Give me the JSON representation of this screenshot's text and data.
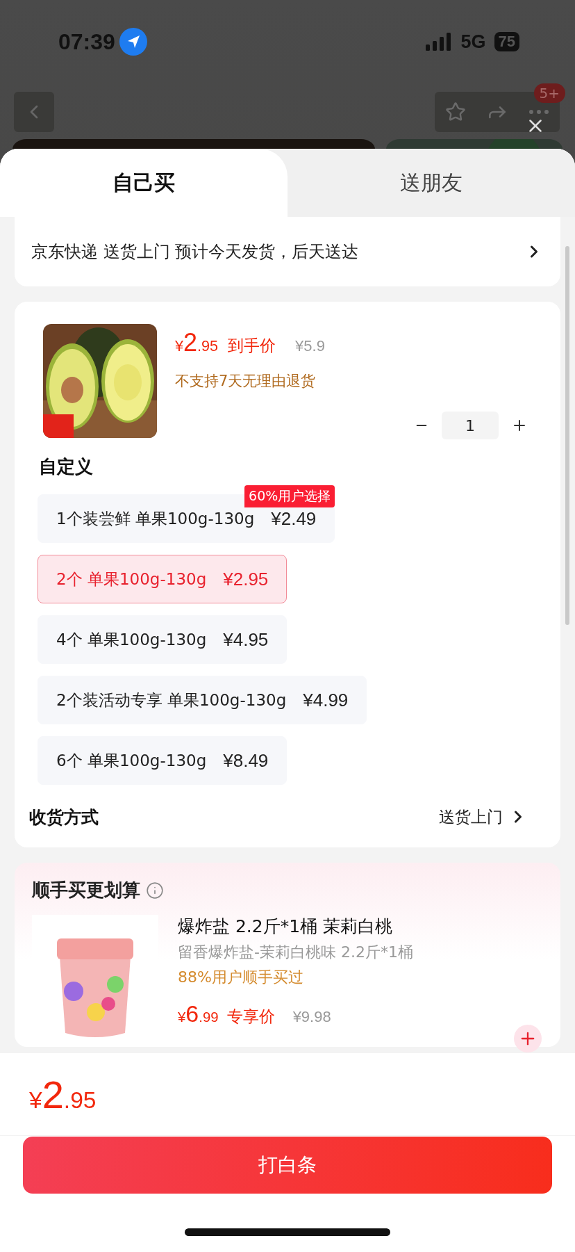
{
  "status_bar": {
    "time": "07:39",
    "network": "5G",
    "battery": "75"
  },
  "nav": {
    "badge": "5+"
  },
  "tabs": [
    {
      "label": "自己买",
      "selected": true
    },
    {
      "label": "送朋友",
      "selected": false
    }
  ],
  "delivery": {
    "text": "京东快递 送货上门 预计今天发货，后天送达"
  },
  "product": {
    "currency": "¥",
    "price_int": "2",
    "price_dec": ".95",
    "price_label": "到手价",
    "original_price": "¥5.9",
    "notice": "不支持7天无理由退货",
    "quantity": "1"
  },
  "spec": {
    "title": "自定义",
    "options": [
      {
        "label": "1个装尝鲜 单果100g-130g",
        "price": "¥2.49",
        "selected": false,
        "badge": "60%用户选择"
      },
      {
        "label": "2个 单果100g-130g",
        "price": "¥2.95",
        "selected": true
      },
      {
        "label": "4个 单果100g-130g",
        "price": "¥4.95",
        "selected": false
      },
      {
        "label": "2个装活动专享 单果100g-130g",
        "price": "¥4.99",
        "selected": false
      },
      {
        "label": "6个 单果100g-130g",
        "price": "¥8.49",
        "selected": false
      }
    ]
  },
  "receive": {
    "label": "收货方式",
    "value": "送货上门"
  },
  "upsell": {
    "title": "顺手买更划算",
    "items": [
      {
        "title": "爆炸盐 2.2斤*1桶 茉莉白桃",
        "subtitle": "留香爆炸盐-茉莉白桃味 2.2斤*1桶",
        "tag": "88%用户顺手买过",
        "currency": "¥",
        "price_int": "6",
        "price_dec": ".99",
        "price_label": "专享价",
        "original_price": "¥9.98"
      }
    ]
  },
  "footer": {
    "currency": "¥",
    "price_int": "2",
    "price_dec": ".95",
    "button": "打白条"
  }
}
